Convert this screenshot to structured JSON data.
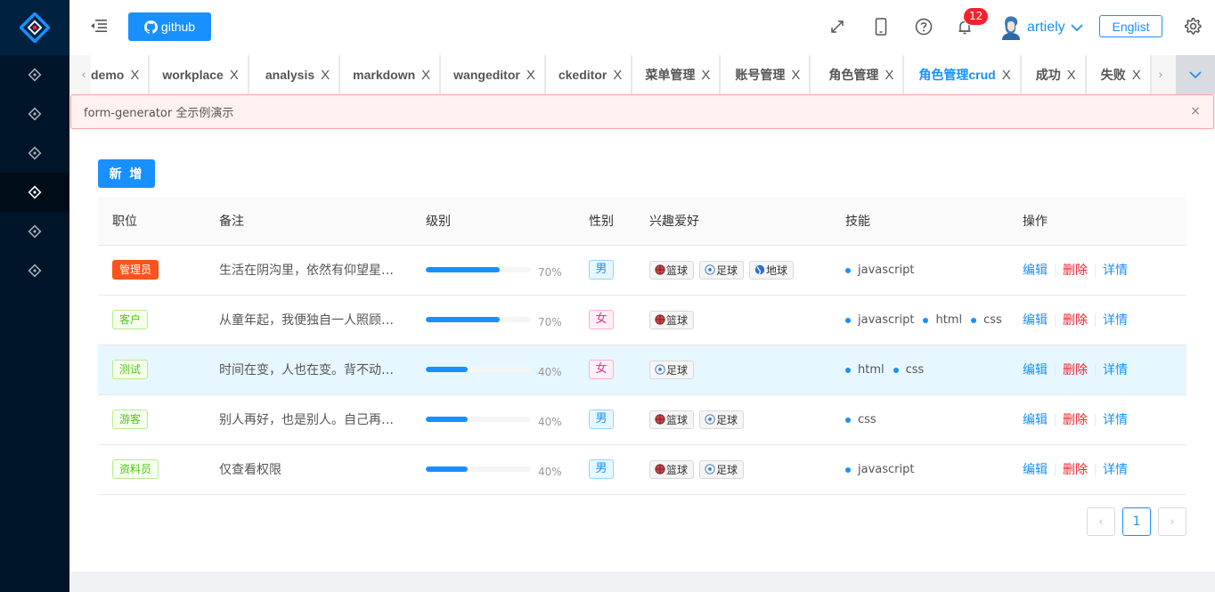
{
  "header": {
    "github_label": "github",
    "notification_count": "12",
    "username": "artiely",
    "lang_label": "Englist"
  },
  "sidebar": {
    "logo": "react-logo",
    "items": [
      {
        "icon": "diamond-icon",
        "active": false
      },
      {
        "icon": "diamond-icon",
        "active": false
      },
      {
        "icon": "diamond-icon",
        "active": false
      },
      {
        "icon": "diamond-icon",
        "active": true
      },
      {
        "icon": "diamond-icon",
        "active": false
      },
      {
        "icon": "diamond-icon",
        "active": false
      }
    ]
  },
  "tabs": {
    "items": [
      {
        "label": "demo",
        "active": false
      },
      {
        "label": "workplace",
        "active": false
      },
      {
        "label": "analysis",
        "active": false
      },
      {
        "label": "markdown",
        "active": false
      },
      {
        "label": "wangeditor",
        "active": false
      },
      {
        "label": "ckeditor",
        "active": false
      },
      {
        "label": "菜单管理",
        "active": false
      },
      {
        "label": "账号管理",
        "active": false
      },
      {
        "label": "角色管理",
        "active": false
      },
      {
        "label": "角色管理crud",
        "active": true
      },
      {
        "label": "成功",
        "active": false
      },
      {
        "label": "失败",
        "active": false
      }
    ],
    "close_glyph": "X",
    "prev_glyph": "‹",
    "next_glyph": "›"
  },
  "alert": {
    "message": "form-generator 全示例演示",
    "close_glyph": "×"
  },
  "main": {
    "add_label": "新 增"
  },
  "table": {
    "columns": [
      "职位",
      "备注",
      "级别",
      "性别",
      "兴趣爱好",
      "技能",
      "操作"
    ],
    "rows": [
      {
        "role": "管理员",
        "role_color": "orange",
        "remark": "生活在阴沟里，依然有仰望星空的权利",
        "level": 70,
        "level_text": "70%",
        "gender": "男",
        "gender_type": "m",
        "hobbies": [
          "篮球",
          "足球",
          "地球"
        ],
        "skills": [
          "javascript"
        ],
        "highlight": false
      },
      {
        "role": "客户",
        "role_color": "green",
        "remark": "从童年起，我便独自一人照顾着历代的星辰",
        "level": 70,
        "level_text": "70%",
        "gender": "女",
        "gender_type": "f",
        "hobbies": [
          "篮球"
        ],
        "skills": [
          "javascript",
          "html",
          "css"
        ],
        "highlight": false
      },
      {
        "role": "测试",
        "role_color": "green",
        "remark": "时间在变，人也在变。背不动的就放下",
        "level": 40,
        "level_text": "40%",
        "gender": "女",
        "gender_type": "f",
        "hobbies": [
          "足球"
        ],
        "skills": [
          "html",
          "css"
        ],
        "highlight": true
      },
      {
        "role": "游客",
        "role_color": "green",
        "remark": "别人再好，也是别人。自己再不堪，也是自己",
        "level": 40,
        "level_text": "40%",
        "gender": "男",
        "gender_type": "m",
        "hobbies": [
          "篮球",
          "足球"
        ],
        "skills": [
          "css"
        ],
        "highlight": false
      },
      {
        "role": "资料员",
        "role_color": "green",
        "remark": "仅查看权限",
        "level": 40,
        "level_text": "40%",
        "gender": "男",
        "gender_type": "m",
        "hobbies": [
          "篮球",
          "足球"
        ],
        "skills": [
          "javascript"
        ],
        "highlight": false
      }
    ],
    "ops": {
      "edit": "编辑",
      "delete": "删除",
      "detail": "详情"
    }
  },
  "pagination": {
    "current": "1",
    "prev_glyph": "‹",
    "next_glyph": "›"
  },
  "colors": {
    "primary": "#1890ff",
    "danger": "#f5222d",
    "sidebar_bg": "#001529"
  }
}
